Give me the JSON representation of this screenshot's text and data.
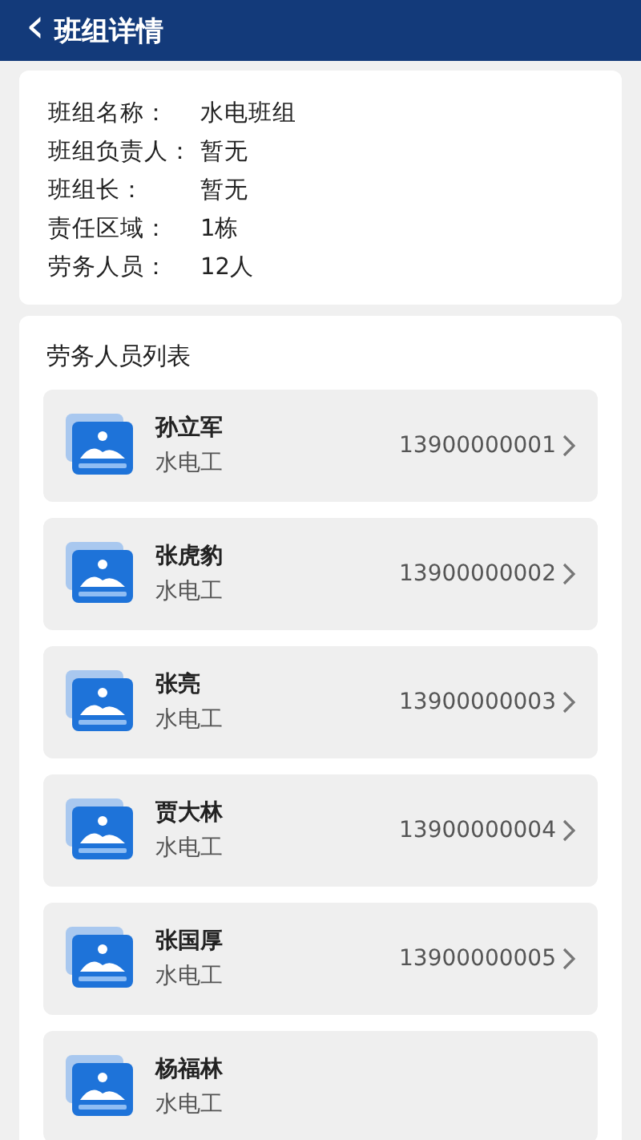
{
  "header": {
    "back_icon": "‹",
    "title": "班组详情"
  },
  "team_info": [
    {
      "label": "班组名称：",
      "value": "水电班组"
    },
    {
      "label": "班组负责人：",
      "value": "暂无"
    },
    {
      "label": "班组长：",
      "value": "暂无"
    },
    {
      "label": "责任区域：",
      "value": "1栋"
    },
    {
      "label": "劳务人员：",
      "value": "12人"
    }
  ],
  "workers": {
    "title": "劳务人员列表",
    "items": [
      {
        "name": "孙立军",
        "role": "水电工",
        "phone": "13900000001"
      },
      {
        "name": "张虎豹",
        "role": "水电工",
        "phone": "13900000002"
      },
      {
        "name": "张亮",
        "role": "水电工",
        "phone": "13900000003"
      },
      {
        "name": "贾大林",
        "role": "水电工",
        "phone": "13900000004"
      },
      {
        "name": "张国厚",
        "role": "水电工",
        "phone": "13900000005"
      },
      {
        "name": "杨福林",
        "role": "水电工"
      }
    ]
  }
}
